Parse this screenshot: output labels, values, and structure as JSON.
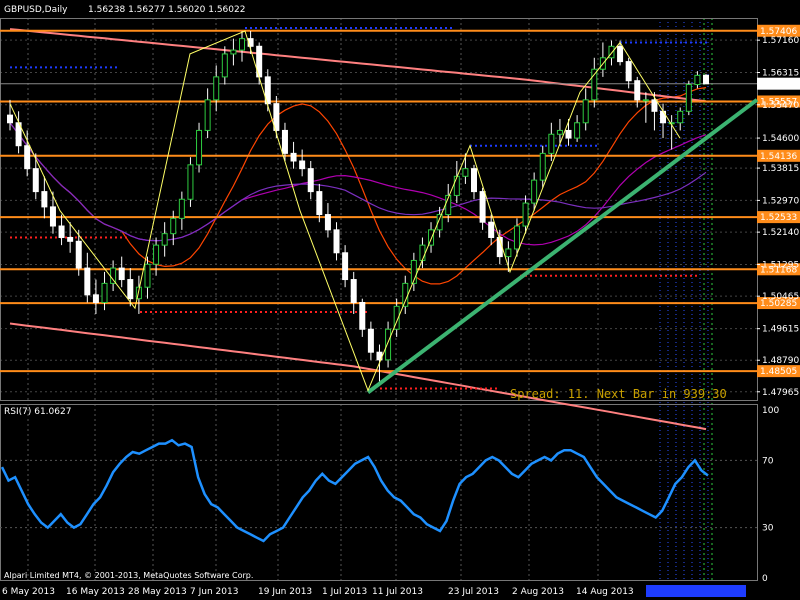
{
  "chart_data": {
    "type": "candlestick",
    "header": {
      "symbol": "GBPUSD,Daily",
      "ohlc": "1.56238 1.56277 1.56020 1.56022"
    },
    "y_ticks": [
      "1.57160",
      "1.56315",
      "1.55470",
      "1.54600",
      "1.53815",
      "1.52970",
      "1.52140",
      "1.51295",
      "1.50465",
      "1.49615",
      "1.48790",
      "1.47965"
    ],
    "current_price": "1.56022",
    "levels": [
      {
        "price": 1.57406,
        "label": "1.57406"
      },
      {
        "price": 1.55557,
        "label": "1.55557"
      },
      {
        "price": 1.54136,
        "label": "1.54136"
      },
      {
        "price": 1.52533,
        "label": "1.52533"
      },
      {
        "price": 1.51168,
        "label": "1.51168"
      },
      {
        "price": 1.50285,
        "label": "1.50285"
      },
      {
        "price": 1.48505,
        "label": "1.48505"
      }
    ],
    "x_ticks": [
      "6 May 2013",
      "16 May 2013",
      "28 May 2013",
      "7 Jun 2013",
      "19 Jun 2013",
      "1 Jul 2013",
      "11 Jul 2013",
      "23 Jul 2013",
      "2 Aug 2013",
      "14 Aug 2013"
    ],
    "candles": {
      "open": [
        1.552,
        1.55,
        1.544,
        1.538,
        1.532,
        1.528,
        1.523,
        1.52,
        1.519,
        1.512,
        1.505,
        1.503,
        1.508,
        1.512,
        1.509,
        1.504,
        1.507,
        1.513,
        1.518,
        1.521,
        1.525,
        1.53,
        1.539,
        1.548,
        1.556,
        1.562,
        1.568,
        1.569,
        1.572,
        1.57,
        1.562,
        1.555,
        1.548,
        1.542,
        1.54,
        1.538,
        1.532,
        1.526,
        1.522,
        1.516,
        1.509,
        1.503,
        1.496,
        1.49,
        1.488,
        1.496,
        1.502,
        1.508,
        1.514,
        1.518,
        1.522,
        1.526,
        1.531,
        1.536,
        1.538,
        1.532,
        1.524,
        1.52,
        1.515,
        1.517,
        1.523,
        1.529,
        1.535,
        1.542,
        1.547,
        1.548,
        1.546,
        1.55,
        1.556,
        1.564,
        1.567,
        1.57,
        1.566,
        1.561,
        1.556,
        1.556,
        1.553,
        1.55,
        1.55,
        1.553,
        1.56,
        1.5624
      ],
      "high": [
        1.556,
        1.553,
        1.548,
        1.542,
        1.536,
        1.532,
        1.526,
        1.524,
        1.522,
        1.516,
        1.509,
        1.511,
        1.514,
        1.515,
        1.512,
        1.51,
        1.515,
        1.52,
        1.524,
        1.527,
        1.532,
        1.541,
        1.55,
        1.559,
        1.565,
        1.57,
        1.572,
        1.574,
        1.574,
        1.571,
        1.564,
        1.557,
        1.55,
        1.545,
        1.543,
        1.54,
        1.534,
        1.529,
        1.524,
        1.518,
        1.511,
        1.504,
        1.498,
        1.492,
        1.498,
        1.504,
        1.51,
        1.516,
        1.52,
        1.524,
        1.528,
        1.534,
        1.54,
        1.542,
        1.539,
        1.533,
        1.526,
        1.522,
        1.519,
        1.525,
        1.531,
        1.537,
        1.544,
        1.55,
        1.551,
        1.551,
        1.552,
        1.559,
        1.567,
        1.571,
        1.5715,
        1.5715,
        1.567,
        1.562,
        1.558,
        1.558,
        1.555,
        1.552,
        1.554,
        1.561,
        1.5635,
        1.5628
      ],
      "low": [
        1.548,
        1.542,
        1.536,
        1.53,
        1.525,
        1.521,
        1.518,
        1.516,
        1.51,
        1.503,
        1.5,
        1.501,
        1.506,
        1.507,
        1.502,
        1.5,
        1.504,
        1.51,
        1.515,
        1.518,
        1.522,
        1.528,
        1.537,
        1.546,
        1.553,
        1.56,
        1.565,
        1.566,
        1.568,
        1.56,
        1.553,
        1.546,
        1.54,
        1.538,
        1.536,
        1.53,
        1.524,
        1.52,
        1.514,
        1.507,
        1.5,
        1.494,
        1.488,
        1.482,
        1.486,
        1.494,
        1.5,
        1.506,
        1.512,
        1.516,
        1.52,
        1.524,
        1.529,
        1.534,
        1.53,
        1.522,
        1.518,
        1.513,
        1.511,
        1.515,
        1.521,
        1.527,
        1.533,
        1.54,
        1.544,
        1.544,
        1.545,
        1.548,
        1.554,
        1.562,
        1.565,
        1.565,
        1.559,
        1.554,
        1.55,
        1.548,
        1.546,
        1.543,
        1.548,
        1.552,
        1.559,
        1.5602
      ],
      "close": [
        1.55,
        1.544,
        1.538,
        1.532,
        1.528,
        1.523,
        1.52,
        1.519,
        1.512,
        1.505,
        1.503,
        1.508,
        1.512,
        1.509,
        1.504,
        1.507,
        1.513,
        1.518,
        1.521,
        1.525,
        1.53,
        1.539,
        1.548,
        1.556,
        1.562,
        1.568,
        1.569,
        1.572,
        1.57,
        1.562,
        1.555,
        1.548,
        1.542,
        1.54,
        1.538,
        1.532,
        1.526,
        1.522,
        1.516,
        1.509,
        1.503,
        1.496,
        1.49,
        1.488,
        1.496,
        1.502,
        1.508,
        1.514,
        1.518,
        1.522,
        1.526,
        1.531,
        1.536,
        1.538,
        1.532,
        1.524,
        1.52,
        1.515,
        1.517,
        1.523,
        1.529,
        1.535,
        1.542,
        1.547,
        1.548,
        1.546,
        1.55,
        1.556,
        1.564,
        1.567,
        1.57,
        1.566,
        1.561,
        1.556,
        1.556,
        1.553,
        1.55,
        1.55,
        1.553,
        1.56,
        1.5624,
        1.5602
      ]
    },
    "rsi": {
      "label": "RSI(7) 61.0627",
      "levels": [
        "100",
        "70",
        "30",
        "0"
      ],
      "values": [
        66,
        58,
        60,
        52,
        44,
        38,
        33,
        30,
        34,
        38,
        33,
        30,
        32,
        38,
        44,
        48,
        55,
        63,
        68,
        72,
        75,
        74,
        76,
        78,
        80,
        80,
        82,
        79,
        80,
        78,
        60,
        50,
        44,
        42,
        38,
        34,
        30,
        28,
        26,
        24,
        22,
        26,
        28,
        30,
        36,
        42,
        48,
        52,
        58,
        62,
        58,
        56,
        60,
        64,
        68,
        70,
        72,
        66,
        58,
        52,
        48,
        46,
        42,
        38,
        36,
        32,
        30,
        28,
        34,
        46,
        56,
        60,
        62,
        66,
        70,
        72,
        70,
        66,
        62,
        60,
        64,
        68,
        70,
        72,
        70,
        74,
        76,
        76,
        74,
        72,
        66,
        60,
        56,
        52,
        48,
        46,
        44,
        42,
        40,
        38,
        36,
        40,
        48,
        56,
        60,
        66,
        70,
        64,
        61
      ]
    },
    "spread_text": "Spread: 11. Next Bar in 939:30",
    "copyright": "Alpari Limited MT4, © 2001-2013, MetaQuotes Software Corp."
  }
}
